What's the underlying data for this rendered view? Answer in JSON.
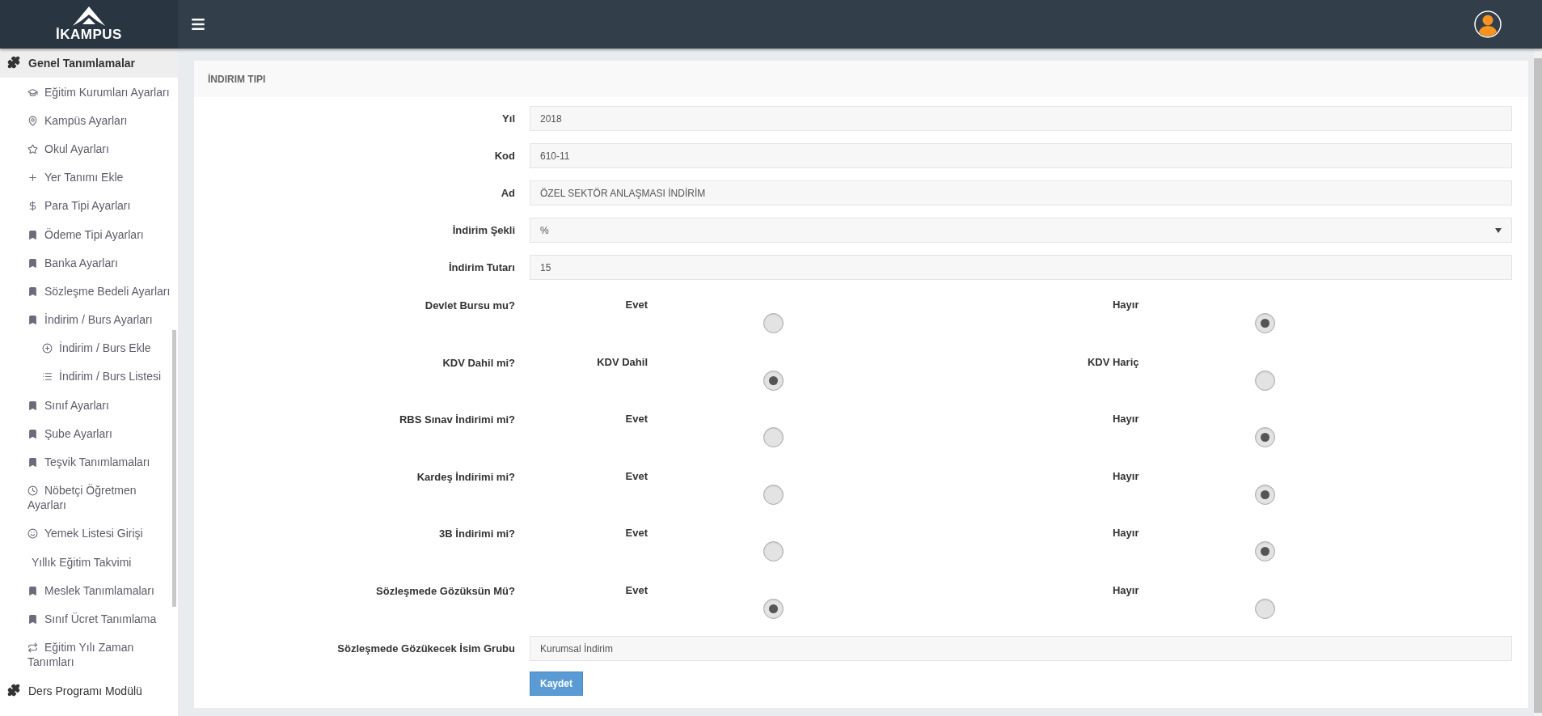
{
  "logo": {
    "text": "İKAMPUS"
  },
  "sidebar": {
    "items": [
      {
        "label": "Genel Tanımlamalar",
        "expanded": true,
        "children": [
          {
            "label": "Eğitim Kurumları Ayarları"
          },
          {
            "label": "Kampüs Ayarları"
          },
          {
            "label": "Okul Ayarları"
          },
          {
            "label": "Yer Tanımı Ekle"
          },
          {
            "label": "Para Tipi Ayarları"
          },
          {
            "label": "Ödeme Tipi Ayarları"
          },
          {
            "label": "Banka Ayarları"
          },
          {
            "label": "Sözleşme Bedeli Ayarları"
          },
          {
            "label": "İndirim / Burs Ayarları",
            "expanded": true,
            "children": [
              {
                "label": "İndirim / Burs Ekle"
              },
              {
                "label": "İndirim / Burs Listesi"
              }
            ]
          },
          {
            "label": "Sınıf Ayarları"
          },
          {
            "label": "Şube Ayarları"
          },
          {
            "label": "Teşvik Tanımlamaları"
          },
          {
            "label": "Nöbetçi Öğretmen Ayarları"
          },
          {
            "label": "Yemek Listesi Girişi"
          },
          {
            "label": "Yıllık Eğitim Takvimi"
          },
          {
            "label": "Meslek Tanımlamaları"
          },
          {
            "label": "Sınıf Ücret Tanımlama"
          },
          {
            "label": "Eğitim Yılı Zaman Tanımları"
          }
        ]
      },
      {
        "label": "Ders Programı Modülü",
        "expanded": false
      }
    ]
  },
  "panel": {
    "title": "İNDIRIM TIPI",
    "fields": [
      {
        "kind": "text",
        "label": "Yıl",
        "value": "2018"
      },
      {
        "kind": "text",
        "label": "Kod",
        "value": "610-11"
      },
      {
        "kind": "text",
        "label": "Ad",
        "value": "ÖZEL SEKTÖR ANLAŞMASI İNDİRİM"
      },
      {
        "kind": "select",
        "label": "İndirim Şekli",
        "value": "%"
      },
      {
        "kind": "text",
        "label": "İndirim Tutarı",
        "value": "15"
      }
    ],
    "radio_groups": [
      {
        "label": "Devlet Bursu mu?",
        "options": [
          {
            "label": "Evet",
            "selected": false
          },
          {
            "label": "Hayır",
            "selected": true
          }
        ]
      },
      {
        "label": "KDV Dahil mi?",
        "options": [
          {
            "label": "KDV Dahil",
            "selected": true
          },
          {
            "label": "KDV Hariç",
            "selected": false
          }
        ]
      },
      {
        "label": "RBS Sınav İndirimi mi?",
        "options": [
          {
            "label": "Evet",
            "selected": false
          },
          {
            "label": "Hayır",
            "selected": true
          }
        ]
      },
      {
        "label": "Kardeş İndirimi mi?",
        "options": [
          {
            "label": "Evet",
            "selected": false
          },
          {
            "label": "Hayır",
            "selected": true
          }
        ]
      },
      {
        "label": "3B İndirimi mi?",
        "options": [
          {
            "label": "Evet",
            "selected": false
          },
          {
            "label": "Hayır",
            "selected": true
          }
        ]
      },
      {
        "label": "Sözleşmede Gözüksün Mü?",
        "options": [
          {
            "label": "Evet",
            "selected": true
          },
          {
            "label": "Hayır",
            "selected": false
          }
        ]
      }
    ],
    "group_field": {
      "label": "Sözleşmede Gözükecek İsim Grubu",
      "value": "Kurumsal İndirim"
    },
    "save_button": "Kaydet"
  }
}
